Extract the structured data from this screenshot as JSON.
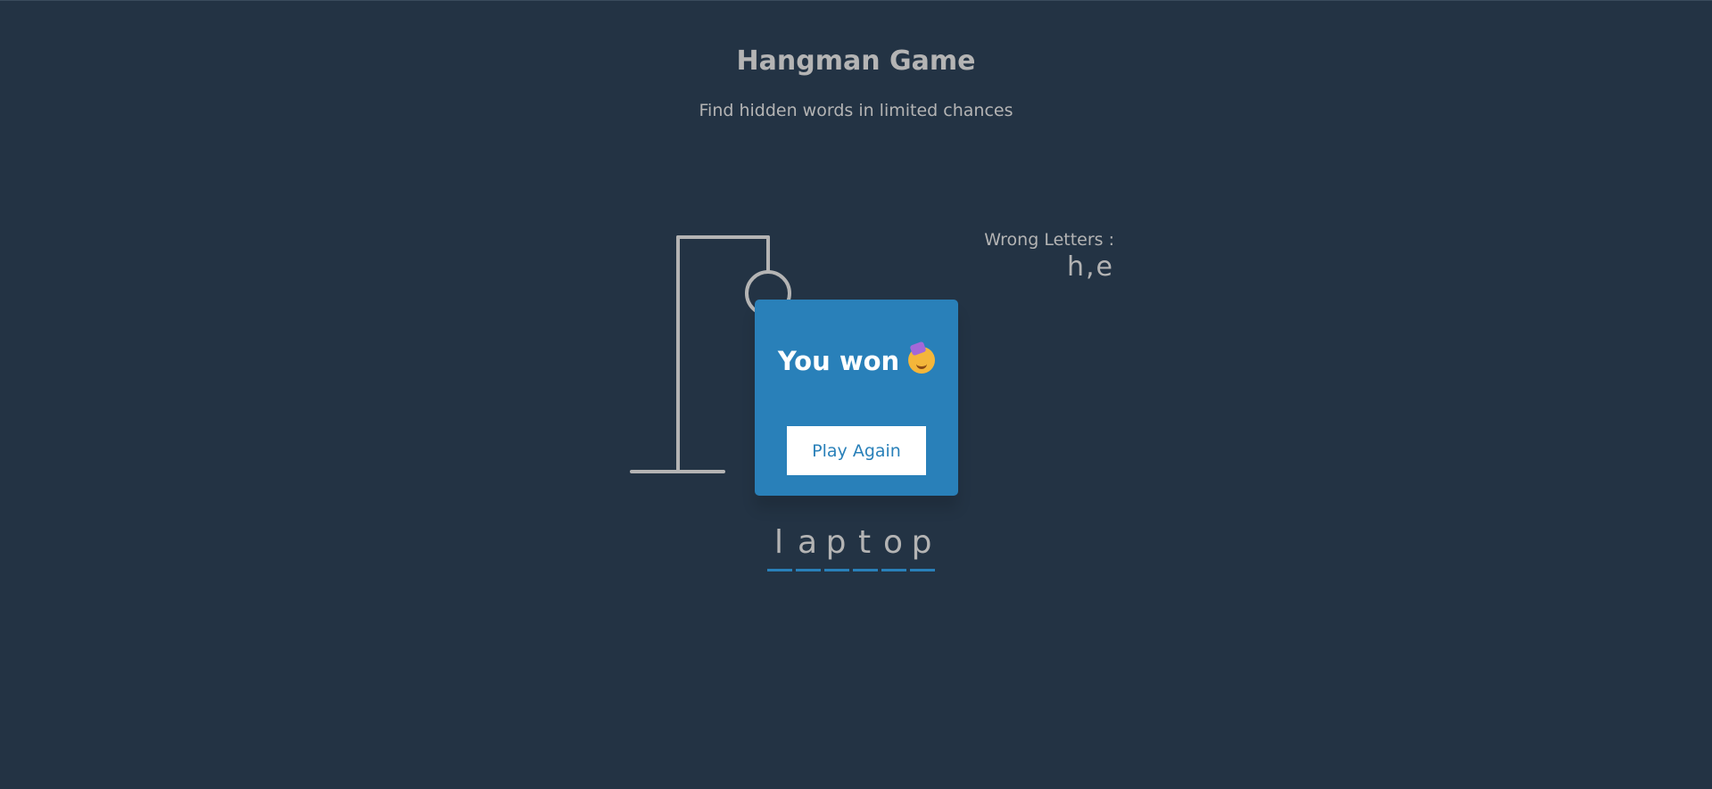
{
  "header": {
    "title": "Hangman Game",
    "subtitle": "Find hidden words in limited chances"
  },
  "wrong_letters": {
    "label": "Wrong Letters :",
    "letters": [
      "h",
      "e"
    ]
  },
  "word": {
    "letters": [
      "l",
      "a",
      "p",
      "t",
      "o",
      "p"
    ]
  },
  "popup": {
    "message": "You won",
    "emoji": "partying-face-icon",
    "button_label": "Play Again"
  },
  "colors": {
    "background": "#233344",
    "accent": "#2980b9",
    "text": "#b4b4b4",
    "button_bg": "#ffffff"
  }
}
